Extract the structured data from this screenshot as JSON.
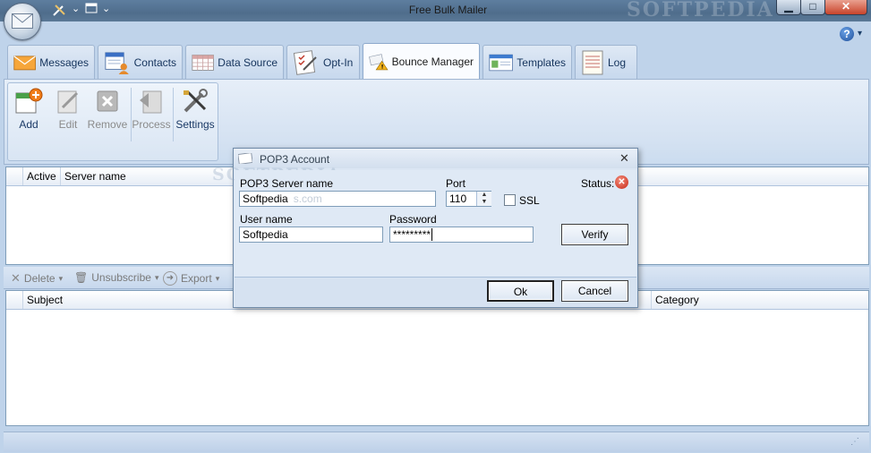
{
  "window": {
    "title": "Free Bulk Mailer",
    "watermark": "SOFTPEDIA"
  },
  "tabs": [
    {
      "label": "Messages"
    },
    {
      "label": "Contacts"
    },
    {
      "label": "Data Source"
    },
    {
      "label": "Opt-In"
    },
    {
      "label": "Bounce Manager",
      "active": true
    },
    {
      "label": "Templates"
    },
    {
      "label": "Log"
    }
  ],
  "ribbon": {
    "buttons": [
      {
        "label": "Add",
        "enabled": true
      },
      {
        "label": "Edit",
        "enabled": false
      },
      {
        "label": "Remove",
        "enabled": false
      },
      {
        "label": "Process",
        "enabled": false
      },
      {
        "label": "Settings",
        "enabled": true
      }
    ]
  },
  "servers_grid": {
    "columns": [
      "Active",
      "Server name"
    ]
  },
  "toolbar2": {
    "delete": "Delete",
    "unsubscribe": "Unsubscribe",
    "export": "Export"
  },
  "messages_grid": {
    "columns": [
      "Subject",
      "Category"
    ]
  },
  "dialog": {
    "title": "POP3 Account",
    "server_label": "POP3 Server name",
    "server_value": "Softpedia",
    "server_ghost": "s.com",
    "port_label": "Port",
    "port_value": "110",
    "ssl_label": "SSL",
    "ssl_checked": false,
    "status_label": "Status:",
    "user_label": "User name",
    "user_value": "Softpedia",
    "password_label": "Password",
    "password_value": "*********",
    "verify_label": "Verify",
    "ok_label": "Ok",
    "cancel_label": "Cancel",
    "watermark": "SOFTPEDIA"
  }
}
